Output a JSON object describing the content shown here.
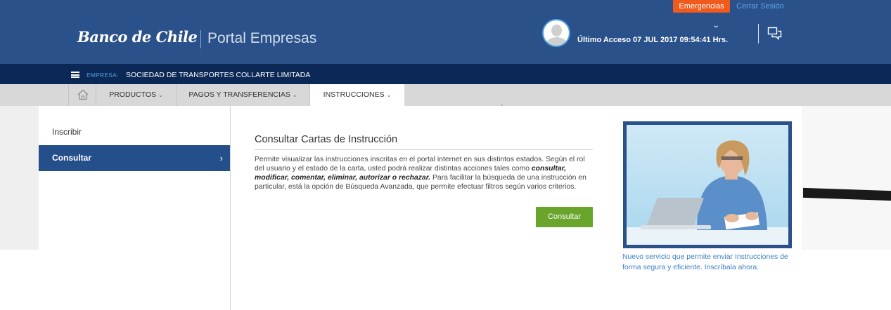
{
  "topbar": {
    "emergency_label": "Emergencias",
    "logout_label": "Cerrar Sesión"
  },
  "header": {
    "bank_name": "Banco de Chile",
    "portal_name": "Portal Empresas",
    "last_access": "Último Acceso 07 JUL 2017 09:54:41 Hrs."
  },
  "company": {
    "label": "EMPRESA:",
    "name": "SOCIEDAD DE TRANSPORTES COLLARTE LIMITADA"
  },
  "nav": {
    "tabs": [
      {
        "label": "PRODUCTOS"
      },
      {
        "label": "PAGOS Y TRANSFERENCIAS"
      },
      {
        "label": "INSTRUCCIONES"
      }
    ],
    "active": "INSTRUCCIONES"
  },
  "sidebar": {
    "items": [
      {
        "label": "Inscribir"
      },
      {
        "label": "Consultar"
      }
    ],
    "active": "Consultar"
  },
  "main": {
    "title": "Consultar Cartas de Instrucción",
    "desc_part1": "Permite visualizar las instrucciones inscritas en el portal internet en sus distintos estados. Según el rol del usuario y el estado de la carta, usted podrá realizar distintas acciones tales como ",
    "desc_bold": "consultar, modificar, comentar, eliminar, autorizar o rechazar.",
    "desc_part2": " Para facilitar la búsqueda de una instrucción en particular, está la opción de Búsqueda Avanzada, que permite efectuar filtros según varios criterios.",
    "button_label": "Consultar"
  },
  "promo": {
    "text": "Nuevo servicio que permite enviar Instrucciones de forma segura y eficiente. Inscríbala ahora."
  },
  "colors": {
    "header_blue": "#2a5189",
    "company_bar": "#0c2857",
    "emergency_orange": "#f05a1a",
    "button_green": "#69a42b",
    "link_blue": "#3a7fc5"
  }
}
